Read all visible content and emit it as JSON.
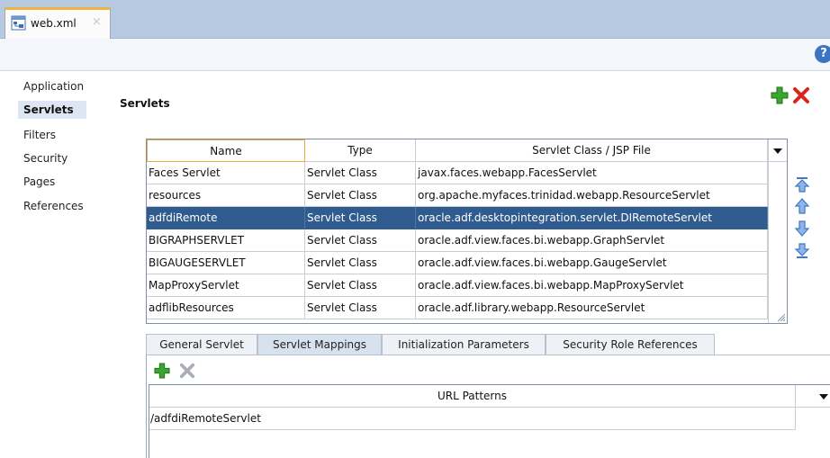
{
  "editor": {
    "tab_label": "web.xml",
    "close_glyph": "×"
  },
  "toolbar": {
    "help_glyph": "?"
  },
  "nav": {
    "items": [
      {
        "label": "Application",
        "selected": false
      },
      {
        "label": "Servlets",
        "selected": true
      },
      {
        "label": "Filters",
        "selected": false
      },
      {
        "label": "Security",
        "selected": false
      },
      {
        "label": "Pages",
        "selected": false
      },
      {
        "label": "References",
        "selected": false
      }
    ]
  },
  "section": {
    "title": "Servlets"
  },
  "servlets_table": {
    "columns": [
      "Name",
      "Type",
      "Servlet Class / JSP File"
    ],
    "rows": [
      {
        "name": "Faces Servlet",
        "type": "Servlet Class",
        "class": "javax.faces.webapp.FacesServlet"
      },
      {
        "name": "resources",
        "type": "Servlet Class",
        "class": "org.apache.myfaces.trinidad.webapp.ResourceServlet"
      },
      {
        "name": "adfdiRemote",
        "type": "Servlet Class",
        "class": "oracle.adf.desktopintegration.servlet.DIRemoteServlet"
      },
      {
        "name": "BIGRAPHSERVLET",
        "type": "Servlet Class",
        "class": "oracle.adf.view.faces.bi.webapp.GraphServlet"
      },
      {
        "name": "BIGAUGESERVLET",
        "type": "Servlet Class",
        "class": "oracle.adf.view.faces.bi.webapp.GaugeServlet"
      },
      {
        "name": "MapProxyServlet",
        "type": "Servlet Class",
        "class": "oracle.adf.view.faces.bi.webapp.MapProxyServlet"
      },
      {
        "name": "adflibResources",
        "type": "Servlet Class",
        "class": "oracle.adf.library.webapp.ResourceServlet"
      }
    ],
    "selected_row": "adfdiRemote"
  },
  "subtabs": {
    "general": "General Servlet",
    "mappings": "Servlet Mappings",
    "init_params": "Initialization Parameters",
    "security_roles": "Security Role References",
    "active": "Servlet Mappings"
  },
  "mappings": {
    "header": "URL Patterns",
    "rows": [
      "/adfdiRemoteServlet"
    ]
  },
  "colors": {
    "selection": "#2f5b8f",
    "tab_strip": "#b8c9e2",
    "active_tab_accent": "#f2b24a",
    "add_green": "#3aa62c",
    "delete_red": "#d9261c",
    "arrow_blue": "#3f78c8"
  },
  "icons": [
    "web-xml-file-icon",
    "help-icon",
    "add-icon",
    "delete-icon",
    "move-top-icon",
    "move-up-icon",
    "move-down-icon",
    "move-bottom-icon",
    "dropdown-icon",
    "resize-grip-icon"
  ]
}
